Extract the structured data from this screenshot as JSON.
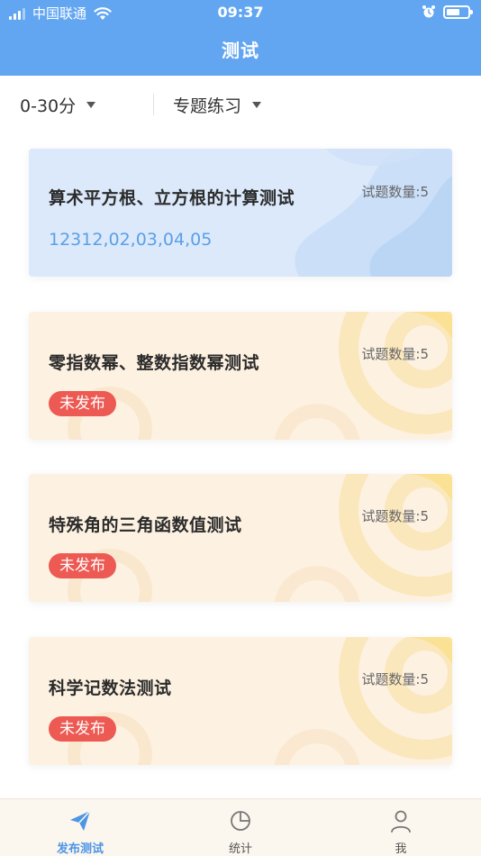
{
  "status_bar": {
    "carrier": "中国联通",
    "time": "09:37"
  },
  "nav": {
    "title": "测试"
  },
  "filters": [
    {
      "label": "0-30分"
    },
    {
      "label": "专题练习"
    }
  ],
  "cards": [
    {
      "title": "算术平方根、立方根的计算测试",
      "count": "试题数量:5",
      "sub": "12312,02,03,04,05",
      "theme": "blue"
    },
    {
      "title": "零指数幂、整数指数幂测试",
      "count": "试题数量:5",
      "badge": "未发布",
      "theme": "peach"
    },
    {
      "title": "特殊角的三角函数值测试",
      "count": "试题数量:5",
      "badge": "未发布",
      "theme": "peach"
    },
    {
      "title": "科学记数法测试",
      "count": "试题数量:5",
      "badge": "未发布",
      "theme": "peach"
    }
  ],
  "tabbar": {
    "items": [
      {
        "label": "发布测试",
        "icon": "paper-plane-icon",
        "active": true
      },
      {
        "label": "统计",
        "icon": "pie-chart-icon",
        "active": false
      },
      {
        "label": "我",
        "icon": "user-icon",
        "active": false
      }
    ]
  },
  "colors": {
    "header": "#62a6f2",
    "accent": "#4d95e6",
    "badge": "#ec5a53",
    "card_blue": "#dbe9fb",
    "card_peach": "#fdf1e1"
  }
}
